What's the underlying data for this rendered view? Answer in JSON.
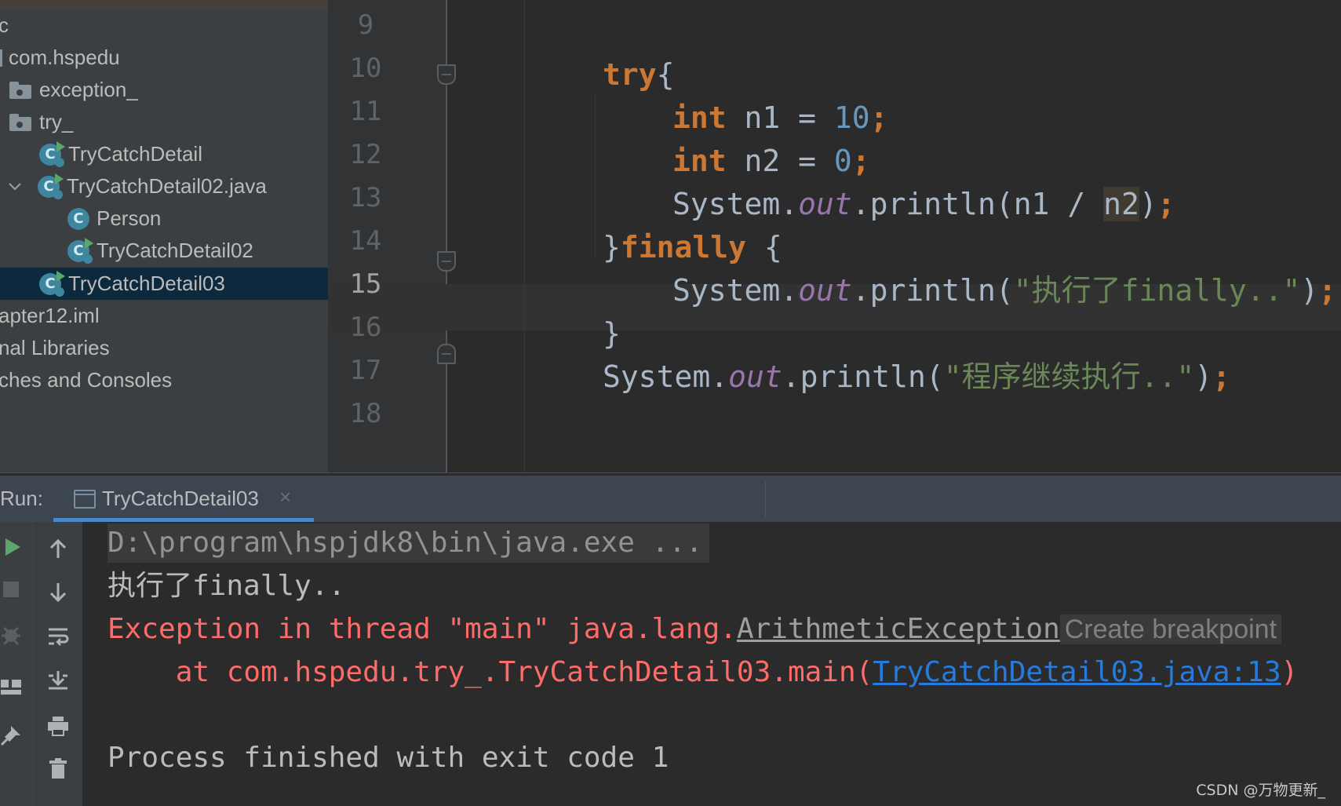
{
  "project_tree": {
    "items": [
      {
        "label": "c",
        "kind": "text"
      },
      {
        "label": "com.hspedu",
        "kind": "package"
      },
      {
        "label": "exception_",
        "kind": "folder"
      },
      {
        "label": "try_",
        "kind": "folder"
      },
      {
        "label": "TryCatchDetail",
        "kind": "class-run"
      },
      {
        "label": "TryCatchDetail02.java",
        "kind": "class-run-expanded"
      },
      {
        "label": "Person",
        "kind": "class"
      },
      {
        "label": "TryCatchDetail02",
        "kind": "class-run"
      },
      {
        "label": "TryCatchDetail03",
        "kind": "class-run",
        "selected": true
      },
      {
        "label": "apter12.iml",
        "kind": "text"
      },
      {
        "label": "nal Libraries",
        "kind": "text"
      },
      {
        "label": "ches and Consoles",
        "kind": "text"
      }
    ]
  },
  "editor": {
    "current_line": "15",
    "line_numbers": [
      "9",
      "10",
      "11",
      "12",
      "13",
      "14",
      "15",
      "16",
      "17",
      "18"
    ],
    "code": {
      "l10": {
        "kw": "try",
        "punct": "{"
      },
      "l11": {
        "kw": "int",
        "ident": " n1 = ",
        "num": "10",
        "semi": ";"
      },
      "l12": {
        "kw": "int",
        "ident": " n2 = ",
        "num": "0",
        "semi": ";"
      },
      "l13": {
        "cls": "System.",
        "field": "out",
        "call": ".println(n1 / ",
        "hl": "n2",
        "close": ")",
        "semi": ";"
      },
      "l14": {
        "open": "}",
        "kw": "finally",
        "rest": " {"
      },
      "l15": {
        "cls": "System.",
        "field": "out",
        "call": ".println(",
        "str": "\"执行了finally..\"",
        "close": ")",
        "semi": ";"
      },
      "l16": {
        "text": "}"
      },
      "l17": {
        "cls": "System.",
        "field": "out",
        "call": ".println(",
        "str": "\"程序继续执行..\"",
        "close": ")",
        "semi": ";"
      }
    }
  },
  "run_panel": {
    "label": "Run:",
    "tab_title": "TryCatchDetail03",
    "tab_close": "×",
    "left_tools": [
      {
        "name": "run-icon",
        "glyph": "▶"
      },
      {
        "name": "stop-icon",
        "glyph": "■"
      },
      {
        "name": "debug-icon",
        "glyph": "✱"
      },
      {
        "name": "layout-icon",
        "glyph": "▀"
      },
      {
        "name": "pin-icon",
        "glyph": "📌"
      }
    ],
    "right_tools": [
      {
        "name": "up-arrow-icon",
        "glyph": "↑"
      },
      {
        "name": "down-arrow-icon",
        "glyph": "↓"
      },
      {
        "name": "soft-wrap-icon",
        "glyph": "≡"
      },
      {
        "name": "scroll-to-end-icon",
        "glyph": "⤓"
      },
      {
        "name": "print-icon",
        "glyph": "⎙"
      },
      {
        "name": "trash-icon",
        "glyph": "🗑"
      }
    ]
  },
  "console": {
    "cmd": "D:\\program\\hspjdk8\\bin\\java.exe ...",
    "out1": "执行了finally..",
    "exception_prefix": "Exception in thread \"main\" java.lang.",
    "exception_name": "ArithmeticException",
    "create_breakpoint": "Create breakpoint",
    "at_prefix": "    at com.hspedu.try_.TryCatchDetail03.main(",
    "at_link": "TryCatchDetail03.java:13",
    "at_suffix": ")",
    "exit": "Process finished with exit code 1"
  },
  "watermark": "CSDN @万物更新_",
  "colors": {
    "keyword": "#cc7832",
    "number": "#6897bb",
    "string": "#6a8759",
    "field": "#9876aa",
    "error": "#ff6b68",
    "link": "#287bde",
    "selection": "#0d293e"
  }
}
